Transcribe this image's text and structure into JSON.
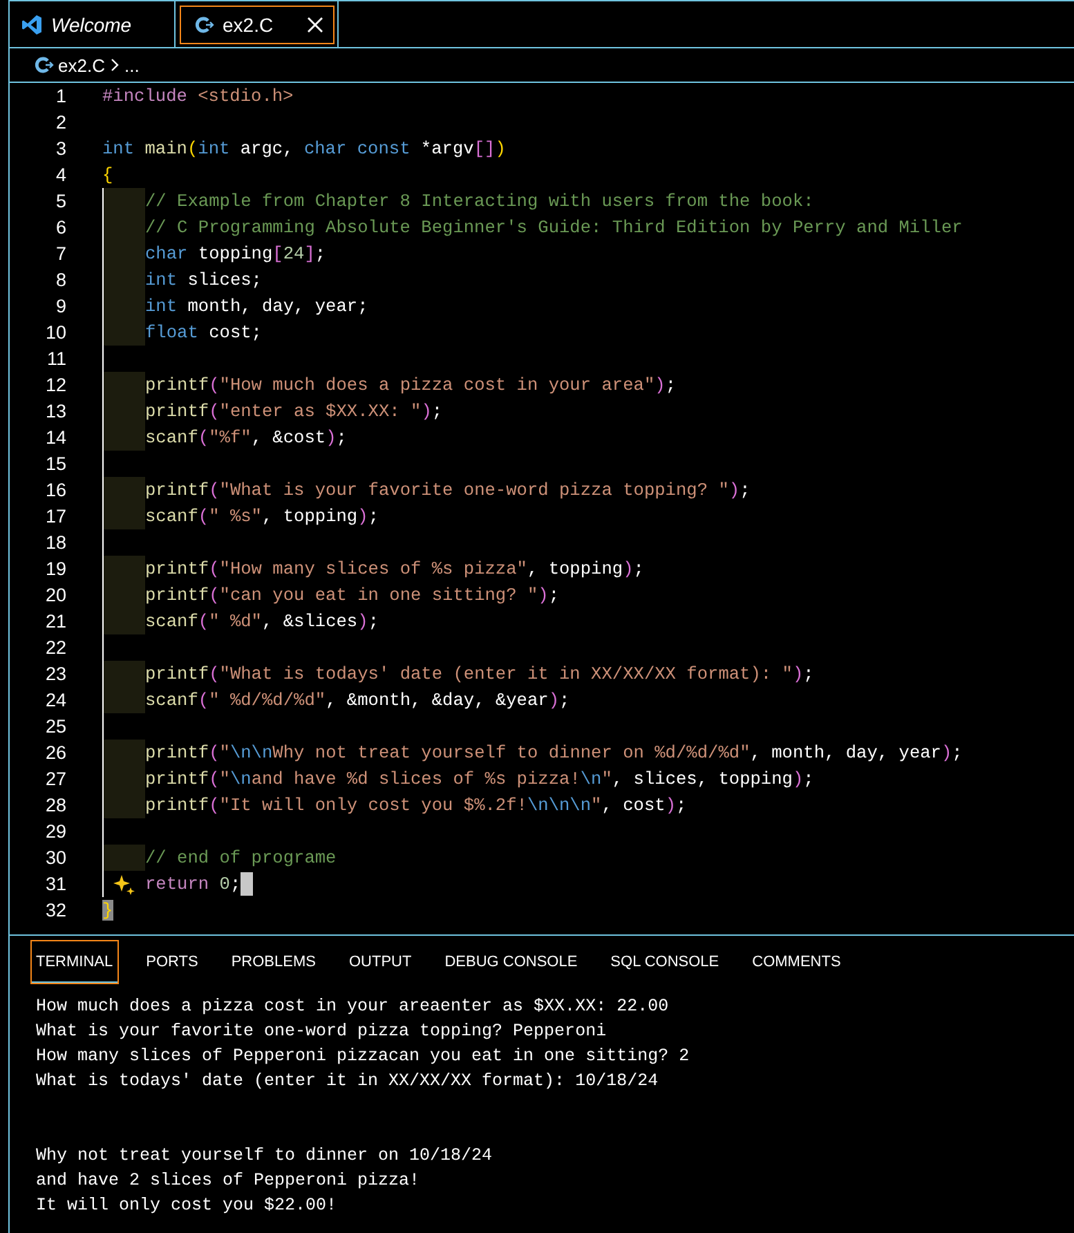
{
  "tabs": [
    {
      "label": "Welcome",
      "kind": "vscode",
      "preview": true,
      "selected": false,
      "closable": false
    },
    {
      "label": "ex2.C",
      "kind": "c",
      "preview": false,
      "selected": true,
      "closable": true
    }
  ],
  "breadcrumb": {
    "file": "ex2.C",
    "rest": "..."
  },
  "editor": {
    "lines": [
      {
        "number": "1",
        "indented": false,
        "tokens": [
          {
            "kind": "pp",
            "text": "#include"
          },
          {
            "kind": "str",
            "text": " <stdio.h>"
          }
        ]
      },
      {
        "number": "2",
        "indented": false
      },
      {
        "number": "3",
        "indented": false,
        "tokens": [
          {
            "kind": "kw",
            "text": "int"
          },
          {
            "kind": "fn",
            "text": " main"
          },
          {
            "kind": "b1",
            "text": "("
          },
          {
            "kind": "kw",
            "text": "int"
          },
          {
            "kind": "pl",
            "text": " argc, "
          },
          {
            "kind": "kw",
            "text": "char"
          },
          {
            "kind": "kw",
            "text": " const"
          },
          {
            "kind": "pl",
            "text": " *argv"
          },
          {
            "kind": "b2",
            "text": "[]"
          },
          {
            "kind": "b1",
            "text": ")"
          }
        ]
      },
      {
        "number": "4",
        "indented": false,
        "tokens": [
          {
            "kind": "b1",
            "text": "{"
          }
        ]
      },
      {
        "number": "5",
        "indented": true,
        "tokens": [
          {
            "kind": "cmt",
            "text": "// Example from Chapter 8 Interacting with users from the book:"
          }
        ]
      },
      {
        "number": "6",
        "indented": true,
        "tokens": [
          {
            "kind": "cmt",
            "text": "// C Programming Absolute Beginner's Guide: Third Edition by Perry and Miller"
          }
        ]
      },
      {
        "number": "7",
        "indented": true,
        "tokens": [
          {
            "kind": "kw",
            "text": "char"
          },
          {
            "kind": "pl",
            "text": " topping"
          },
          {
            "kind": "b2",
            "text": "["
          },
          {
            "kind": "num",
            "text": "24"
          },
          {
            "kind": "b2",
            "text": "]"
          },
          {
            "kind": "pl",
            "text": ";"
          }
        ]
      },
      {
        "number": "8",
        "indented": true,
        "tokens": [
          {
            "kind": "kw",
            "text": "int"
          },
          {
            "kind": "pl",
            "text": " slices;"
          }
        ]
      },
      {
        "number": "9",
        "indented": true,
        "tokens": [
          {
            "kind": "kw",
            "text": "int"
          },
          {
            "kind": "pl",
            "text": " month, day, year;"
          }
        ]
      },
      {
        "number": "10",
        "indented": true,
        "tokens": [
          {
            "kind": "kw",
            "text": "float"
          },
          {
            "kind": "pl",
            "text": " cost;"
          }
        ]
      },
      {
        "number": "11",
        "indented": false
      },
      {
        "number": "12",
        "indented": true,
        "tokens": [
          {
            "kind": "fn",
            "text": "printf"
          },
          {
            "kind": "b2",
            "text": "("
          },
          {
            "kind": "str",
            "text": "\"How much does a pizza cost in your area\""
          },
          {
            "kind": "b2",
            "text": ")"
          },
          {
            "kind": "pl",
            "text": ";"
          }
        ]
      },
      {
        "number": "13",
        "indented": true,
        "tokens": [
          {
            "kind": "fn",
            "text": "printf"
          },
          {
            "kind": "b2",
            "text": "("
          },
          {
            "kind": "str",
            "text": "\"enter as $XX.XX: \""
          },
          {
            "kind": "b2",
            "text": ")"
          },
          {
            "kind": "pl",
            "text": ";"
          }
        ]
      },
      {
        "number": "14",
        "indented": true,
        "tokens": [
          {
            "kind": "fn",
            "text": "scanf"
          },
          {
            "kind": "b2",
            "text": "("
          },
          {
            "kind": "str",
            "text": "\"%f\""
          },
          {
            "kind": "pl",
            "text": ", &cost"
          },
          {
            "kind": "b2",
            "text": ")"
          },
          {
            "kind": "pl",
            "text": ";"
          }
        ]
      },
      {
        "number": "15",
        "indented": false
      },
      {
        "number": "16",
        "indented": true,
        "tokens": [
          {
            "kind": "fn",
            "text": "printf"
          },
          {
            "kind": "b2",
            "text": "("
          },
          {
            "kind": "str",
            "text": "\"What is your favorite one-word pizza topping? \""
          },
          {
            "kind": "b2",
            "text": ")"
          },
          {
            "kind": "pl",
            "text": ";"
          }
        ]
      },
      {
        "number": "17",
        "indented": true,
        "tokens": [
          {
            "kind": "fn",
            "text": "scanf"
          },
          {
            "kind": "b2",
            "text": "("
          },
          {
            "kind": "str",
            "text": "\" %s\""
          },
          {
            "kind": "pl",
            "text": ", topping"
          },
          {
            "kind": "b2",
            "text": ")"
          },
          {
            "kind": "pl",
            "text": ";"
          }
        ]
      },
      {
        "number": "18",
        "indented": false
      },
      {
        "number": "19",
        "indented": true,
        "tokens": [
          {
            "kind": "fn",
            "text": "printf"
          },
          {
            "kind": "b2",
            "text": "("
          },
          {
            "kind": "str",
            "text": "\"How many slices of %s pizza\""
          },
          {
            "kind": "pl",
            "text": ", topping"
          },
          {
            "kind": "b2",
            "text": ")"
          },
          {
            "kind": "pl",
            "text": ";"
          }
        ]
      },
      {
        "number": "20",
        "indented": true,
        "tokens": [
          {
            "kind": "fn",
            "text": "printf"
          },
          {
            "kind": "b2",
            "text": "("
          },
          {
            "kind": "str",
            "text": "\"can you eat in one sitting? \""
          },
          {
            "kind": "b2",
            "text": ")"
          },
          {
            "kind": "pl",
            "text": ";"
          }
        ]
      },
      {
        "number": "21",
        "indented": true,
        "tokens": [
          {
            "kind": "fn",
            "text": "scanf"
          },
          {
            "kind": "b2",
            "text": "("
          },
          {
            "kind": "str",
            "text": "\" %d\""
          },
          {
            "kind": "pl",
            "text": ", &slices"
          },
          {
            "kind": "b2",
            "text": ")"
          },
          {
            "kind": "pl",
            "text": ";"
          }
        ]
      },
      {
        "number": "22",
        "indented": false
      },
      {
        "number": "23",
        "indented": true,
        "tokens": [
          {
            "kind": "fn",
            "text": "printf"
          },
          {
            "kind": "b2",
            "text": "("
          },
          {
            "kind": "str",
            "text": "\"What is todays' date (enter it in XX/XX/XX format): \""
          },
          {
            "kind": "b2",
            "text": ")"
          },
          {
            "kind": "pl",
            "text": ";"
          }
        ]
      },
      {
        "number": "24",
        "indented": true,
        "tokens": [
          {
            "kind": "fn",
            "text": "scanf"
          },
          {
            "kind": "b2",
            "text": "("
          },
          {
            "kind": "str",
            "text": "\" %d/%d/%d\""
          },
          {
            "kind": "pl",
            "text": ", &month, &day, &year"
          },
          {
            "kind": "b2",
            "text": ")"
          },
          {
            "kind": "pl",
            "text": ";"
          }
        ]
      },
      {
        "number": "25",
        "indented": false
      },
      {
        "number": "26",
        "indented": true,
        "tokens": [
          {
            "kind": "fn",
            "text": "printf"
          },
          {
            "kind": "b2",
            "text": "("
          },
          {
            "kind": "str",
            "text": "\""
          },
          {
            "kind": "esc",
            "text": "\\n\\n"
          },
          {
            "kind": "str",
            "text": "Why not treat yourself to dinner on %d/%d/%d\""
          },
          {
            "kind": "pl",
            "text": ", month, day, year"
          },
          {
            "kind": "b2",
            "text": ")"
          },
          {
            "kind": "pl",
            "text": ";"
          }
        ]
      },
      {
        "number": "27",
        "indented": true,
        "tokens": [
          {
            "kind": "fn",
            "text": "printf"
          },
          {
            "kind": "b2",
            "text": "("
          },
          {
            "kind": "str",
            "text": "\""
          },
          {
            "kind": "esc",
            "text": "\\n"
          },
          {
            "kind": "str",
            "text": "and have %d slices of %s pizza!"
          },
          {
            "kind": "esc",
            "text": "\\n"
          },
          {
            "kind": "str",
            "text": "\""
          },
          {
            "kind": "pl",
            "text": ", slices, topping"
          },
          {
            "kind": "b2",
            "text": ")"
          },
          {
            "kind": "pl",
            "text": ";"
          }
        ]
      },
      {
        "number": "28",
        "indented": true,
        "tokens": [
          {
            "kind": "fn",
            "text": "printf"
          },
          {
            "kind": "b2",
            "text": "("
          },
          {
            "kind": "str",
            "text": "\"It will only cost you $%.2f!"
          },
          {
            "kind": "esc",
            "text": "\\n\\n\\n"
          },
          {
            "kind": "str",
            "text": "\""
          },
          {
            "kind": "pl",
            "text": ", cost"
          },
          {
            "kind": "b2",
            "text": ")"
          },
          {
            "kind": "pl",
            "text": ";"
          }
        ]
      },
      {
        "number": "29",
        "indented": false
      },
      {
        "number": "30",
        "indented": true,
        "tokens": [
          {
            "kind": "cmt",
            "text": "// end of programe"
          }
        ]
      },
      {
        "number": "31",
        "indented": true,
        "sparkle": true,
        "cursor": true,
        "tokens": [
          {
            "kind": "pp",
            "text": "return"
          },
          {
            "kind": "num",
            "text": " 0"
          },
          {
            "kind": "pl",
            "text": ";"
          }
        ]
      },
      {
        "number": "32",
        "indented": false,
        "bracket_match": true,
        "tokens": [
          {
            "kind": "b1",
            "text": "}"
          }
        ]
      }
    ]
  },
  "panel": {
    "tabs": [
      {
        "label": "TERMINAL",
        "selected": true
      },
      {
        "label": "PORTS",
        "selected": false
      },
      {
        "label": "PROBLEMS",
        "selected": false
      },
      {
        "label": "OUTPUT",
        "selected": false
      },
      {
        "label": "DEBUG CONSOLE",
        "selected": false
      },
      {
        "label": "SQL CONSOLE",
        "selected": false
      },
      {
        "label": "COMMENTS",
        "selected": false
      }
    ],
    "output_blocks": [
      {
        "lines": [
          "How much does a pizza cost in your areaenter as $XX.XX: 22.00",
          "What is your favorite one-word pizza topping? Pepperoni",
          "How many slices of Pepperoni pizzacan you eat in one sitting? 2",
          "What is todays' date (enter it in XX/XX/XX format): 10/18/24"
        ]
      },
      {
        "lines": [
          "Why not treat yourself to dinner on 10/18/24",
          "and have 2 slices of Pepperoni pizza!",
          "It will only cost you $22.00!"
        ]
      }
    ]
  }
}
